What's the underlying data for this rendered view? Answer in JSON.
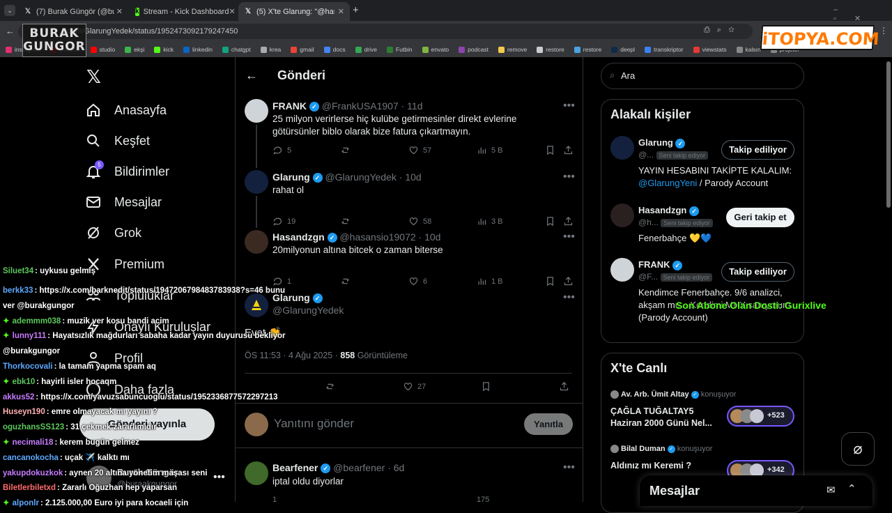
{
  "browser": {
    "tabs": [
      {
        "title": "(7) Burak Güngör (@buraakgun",
        "icon": "x-logo-icon"
      },
      {
        "title": "Stream - Kick Dashboard",
        "icon": "kick-icon"
      },
      {
        "title": "(5) X'te Glarung: \"@hasansio19",
        "icon": "x-logo-icon"
      }
    ],
    "url": "x.com/GlarungYedek/status/1952473092179247450",
    "bookmarks": [
      "instagram",
      "youtube",
      "studio",
      "ekşi",
      "kick",
      "linkedin",
      "chatgpt",
      "krea",
      "gmail",
      "docs",
      "drive",
      "Futbin",
      "envato",
      "podcast",
      "remove",
      "restore",
      "restore",
      "deepl",
      "transkriptor",
      "viewstats",
      "kalsın",
      "projeler"
    ]
  },
  "watermarks": {
    "left_logo": "BURAK GUNGOR",
    "right_logo": "iTOPYA.COM"
  },
  "sidebar": {
    "items": [
      {
        "label": "Anasayfa",
        "icon": "home-icon"
      },
      {
        "label": "Keşfet",
        "icon": "search-icon"
      },
      {
        "label": "Bildirimler",
        "icon": "bell-icon",
        "badge": "5"
      },
      {
        "label": "Mesajlar",
        "icon": "mail-icon"
      },
      {
        "label": "Grok",
        "icon": "grok-icon"
      },
      {
        "label": "Premium",
        "icon": "x-premium-icon"
      },
      {
        "label": "Topluluklar",
        "icon": "communities-icon"
      },
      {
        "label": "Onaylı Kuruluşlar",
        "icon": "lightning-icon"
      },
      {
        "label": "Profil",
        "icon": "profile-icon"
      },
      {
        "label": "Daha fazla",
        "icon": "more-icon"
      }
    ],
    "post_button": "Gönderi yayınla",
    "account_name": "Burak Güngör",
    "account_handle": "@buraakgungor"
  },
  "main": {
    "header_title": "Gönderi",
    "tweets": [
      {
        "name": "FRANK",
        "handle": "@FrankUSA1907",
        "age": "11d",
        "text": "25 milyon verirlerse hiç kulübe getirmesinler direkt evlerine götürsünler biblo olarak bize fatura çıkartmayın.",
        "replies": "5",
        "likes": "57",
        "views": "5 B"
      },
      {
        "name": "Glarung",
        "handle": "@GlarungYedek",
        "age": "10d",
        "text": "rahat ol",
        "replies": "19",
        "likes": "58",
        "views": "3 B"
      },
      {
        "name": "Hasandzgn",
        "handle": "@hasansio19072",
        "age": "10d",
        "text": "20milyonun altına bitcek o zaman biterse",
        "replies": "1",
        "likes": "6",
        "views": "1 B"
      }
    ],
    "focus": {
      "name": "Glarung",
      "handle": "@GlarungYedek",
      "text": "Evet 👏",
      "time": "ÖS 11:53 · 4 Ağu 2025 · ",
      "views_count": "858",
      "views_label": " Görüntüleme",
      "likes": "27"
    },
    "reply_placeholder": "Yanıtını gönder",
    "reply_button": "Yanıtla",
    "next_tweet": {
      "name": "Bearfener",
      "handle": "@bearfener",
      "age": "6d",
      "text": "iptal oldu diyorlar",
      "replies": "1",
      "views": "175"
    }
  },
  "right": {
    "search_placeholder": "Ara",
    "people_title": "Alakalı kişiler",
    "people": [
      {
        "name": "Glarung",
        "handle": "@...",
        "badge": "Seni takip ediyor",
        "button": "Takip ediliyor",
        "bio_a": "YAYIN HESABINI TAKİPTE KALALIM: ",
        "bio_link": "@GlarungYeni",
        "bio_b": " / Parody Account"
      },
      {
        "name": "Hasandzgn",
        "handle": "@h...",
        "badge": "Seni takip ediyor",
        "button": "Geri takip et",
        "bio_a": "Fenerbahçe 💛💙",
        "bio_link": "",
        "bio_b": ""
      },
      {
        "name": "FRANK",
        "handle": "@F...",
        "badge": "Seni takip ediyor",
        "button": "Takip ediliyor",
        "bio_a": "Kendimce Fenerbahçe. 9/6 analizci, akşam mu... Kendimi MHY sanıyorum. (Parody Account)",
        "bio_link": "",
        "bio_b": ""
      }
    ],
    "live_title": "X'te Canlı",
    "spaces": [
      {
        "host": "Av. Arb. Ümit Altay",
        "status": "konuşuyor",
        "title": "ÇAĞLA TUĞALTAY5 Haziran 2000 Günü Nel...",
        "count": "+523"
      },
      {
        "host": "Bilal Duman",
        "status": "konuşuyor",
        "title": "Aldınız mı Keremi ?",
        "count": "+342"
      }
    ],
    "messages_title": "Mesajlar"
  },
  "overlay": {
    "sub_text": "Son Abone Olan Dosti: Gurixlive",
    "chat": [
      {
        "user": "Siluet34",
        "color": "#5cc85c",
        "msg": ": uykusu gelmiş",
        "icon": false
      },
      {
        "user": "berkk33",
        "color": "#5fa8ff",
        "msg": ": https://x.com/barknedit/status/1947206798483783938?s=46 bunu",
        "icon": false
      },
      {
        "user": "",
        "color": "#fff",
        "msg": "ver @burakgungor",
        "icon": false
      },
      {
        "user": "ademmm038",
        "color": "#5cc85c",
        "msg": ": muzik ver kosu bandi acim",
        "icon": true
      },
      {
        "user": "lunny111",
        "color": "#c67bff",
        "msg": ": Hayatsızlık mağdurları sabaha kadar yayın duyurusu bekliyor",
        "icon": true
      },
      {
        "user": "",
        "color": "#fff",
        "msg": "@burakgungor",
        "icon": false
      },
      {
        "user": "Thorkocovali",
        "color": "#5fa8ff",
        "msg": ": la tamam yapma spam aq",
        "icon": false
      },
      {
        "user": "ebk10",
        "color": "#5cc85c",
        "msg": ": hayirli isler hocaqm",
        "icon": true
      },
      {
        "user": "akkus52",
        "color": "#c67bff",
        "msg": ": https://x.com/yavuzsabuncuoglu/status/1952336877572297213",
        "icon": false
      },
      {
        "user": "Huseyn190",
        "color": "#ffb0b0",
        "msg": ": emre olmayacak mı yayını ?",
        "icon": false
      },
      {
        "user": "oguzhansSS123",
        "color": "#5cc85c",
        "msg": ": 31 çekmek zararlımıdır",
        "icon": false
      },
      {
        "user": "necimali18",
        "color": "#c67bff",
        "msg": ": kerem bugün gelmez",
        "icon": true
      },
      {
        "user": "cancanokocha",
        "color": "#5fa8ff",
        "msg": ": uçak ✈️ kalktı mı",
        "icon": false
      },
      {
        "user": "yakupdokuzkok",
        "color": "#c67bff",
        "msg": ": aynen 20 altına yönetim maşası seni",
        "icon": false
      },
      {
        "user": "Biletlerbiletxd",
        "color": "#ff6b6b",
        "msg": ": Zararlı Oğuzhan hep yaparsan",
        "icon": false
      },
      {
        "user": "alponlr",
        "color": "#5fa8ff",
        "msg": ": 2.125.000,00 Euro iyi para kocaeli için",
        "icon": true
      }
    ]
  }
}
